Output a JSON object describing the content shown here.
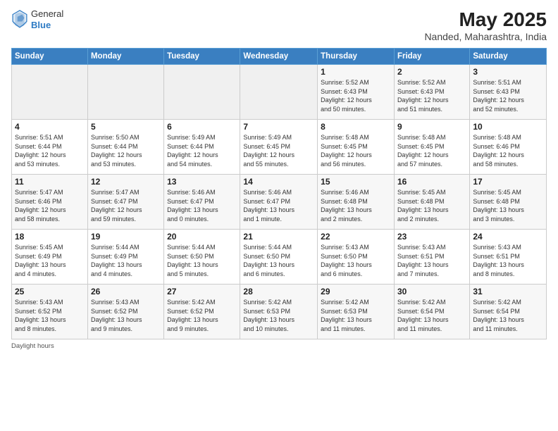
{
  "header": {
    "logo_line1": "General",
    "logo_line2": "Blue",
    "month_title": "May 2025",
    "location": "Nanded, Maharashtra, India"
  },
  "weekdays": [
    "Sunday",
    "Monday",
    "Tuesday",
    "Wednesday",
    "Thursday",
    "Friday",
    "Saturday"
  ],
  "footer": "Daylight hours",
  "weeks": [
    [
      {
        "day": "",
        "info": ""
      },
      {
        "day": "",
        "info": ""
      },
      {
        "day": "",
        "info": ""
      },
      {
        "day": "",
        "info": ""
      },
      {
        "day": "1",
        "info": "Sunrise: 5:52 AM\nSunset: 6:43 PM\nDaylight: 12 hours\nand 50 minutes."
      },
      {
        "day": "2",
        "info": "Sunrise: 5:52 AM\nSunset: 6:43 PM\nDaylight: 12 hours\nand 51 minutes."
      },
      {
        "day": "3",
        "info": "Sunrise: 5:51 AM\nSunset: 6:43 PM\nDaylight: 12 hours\nand 52 minutes."
      }
    ],
    [
      {
        "day": "4",
        "info": "Sunrise: 5:51 AM\nSunset: 6:44 PM\nDaylight: 12 hours\nand 53 minutes."
      },
      {
        "day": "5",
        "info": "Sunrise: 5:50 AM\nSunset: 6:44 PM\nDaylight: 12 hours\nand 53 minutes."
      },
      {
        "day": "6",
        "info": "Sunrise: 5:49 AM\nSunset: 6:44 PM\nDaylight: 12 hours\nand 54 minutes."
      },
      {
        "day": "7",
        "info": "Sunrise: 5:49 AM\nSunset: 6:45 PM\nDaylight: 12 hours\nand 55 minutes."
      },
      {
        "day": "8",
        "info": "Sunrise: 5:48 AM\nSunset: 6:45 PM\nDaylight: 12 hours\nand 56 minutes."
      },
      {
        "day": "9",
        "info": "Sunrise: 5:48 AM\nSunset: 6:45 PM\nDaylight: 12 hours\nand 57 minutes."
      },
      {
        "day": "10",
        "info": "Sunrise: 5:48 AM\nSunset: 6:46 PM\nDaylight: 12 hours\nand 58 minutes."
      }
    ],
    [
      {
        "day": "11",
        "info": "Sunrise: 5:47 AM\nSunset: 6:46 PM\nDaylight: 12 hours\nand 58 minutes."
      },
      {
        "day": "12",
        "info": "Sunrise: 5:47 AM\nSunset: 6:47 PM\nDaylight: 12 hours\nand 59 minutes."
      },
      {
        "day": "13",
        "info": "Sunrise: 5:46 AM\nSunset: 6:47 PM\nDaylight: 13 hours\nand 0 minutes."
      },
      {
        "day": "14",
        "info": "Sunrise: 5:46 AM\nSunset: 6:47 PM\nDaylight: 13 hours\nand 1 minute."
      },
      {
        "day": "15",
        "info": "Sunrise: 5:46 AM\nSunset: 6:48 PM\nDaylight: 13 hours\nand 2 minutes."
      },
      {
        "day": "16",
        "info": "Sunrise: 5:45 AM\nSunset: 6:48 PM\nDaylight: 13 hours\nand 2 minutes."
      },
      {
        "day": "17",
        "info": "Sunrise: 5:45 AM\nSunset: 6:48 PM\nDaylight: 13 hours\nand 3 minutes."
      }
    ],
    [
      {
        "day": "18",
        "info": "Sunrise: 5:45 AM\nSunset: 6:49 PM\nDaylight: 13 hours\nand 4 minutes."
      },
      {
        "day": "19",
        "info": "Sunrise: 5:44 AM\nSunset: 6:49 PM\nDaylight: 13 hours\nand 4 minutes."
      },
      {
        "day": "20",
        "info": "Sunrise: 5:44 AM\nSunset: 6:50 PM\nDaylight: 13 hours\nand 5 minutes."
      },
      {
        "day": "21",
        "info": "Sunrise: 5:44 AM\nSunset: 6:50 PM\nDaylight: 13 hours\nand 6 minutes."
      },
      {
        "day": "22",
        "info": "Sunrise: 5:43 AM\nSunset: 6:50 PM\nDaylight: 13 hours\nand 6 minutes."
      },
      {
        "day": "23",
        "info": "Sunrise: 5:43 AM\nSunset: 6:51 PM\nDaylight: 13 hours\nand 7 minutes."
      },
      {
        "day": "24",
        "info": "Sunrise: 5:43 AM\nSunset: 6:51 PM\nDaylight: 13 hours\nand 8 minutes."
      }
    ],
    [
      {
        "day": "25",
        "info": "Sunrise: 5:43 AM\nSunset: 6:52 PM\nDaylight: 13 hours\nand 8 minutes."
      },
      {
        "day": "26",
        "info": "Sunrise: 5:43 AM\nSunset: 6:52 PM\nDaylight: 13 hours\nand 9 minutes."
      },
      {
        "day": "27",
        "info": "Sunrise: 5:42 AM\nSunset: 6:52 PM\nDaylight: 13 hours\nand 9 minutes."
      },
      {
        "day": "28",
        "info": "Sunrise: 5:42 AM\nSunset: 6:53 PM\nDaylight: 13 hours\nand 10 minutes."
      },
      {
        "day": "29",
        "info": "Sunrise: 5:42 AM\nSunset: 6:53 PM\nDaylight: 13 hours\nand 11 minutes."
      },
      {
        "day": "30",
        "info": "Sunrise: 5:42 AM\nSunset: 6:54 PM\nDaylight: 13 hours\nand 11 minutes."
      },
      {
        "day": "31",
        "info": "Sunrise: 5:42 AM\nSunset: 6:54 PM\nDaylight: 13 hours\nand 11 minutes."
      }
    ]
  ]
}
